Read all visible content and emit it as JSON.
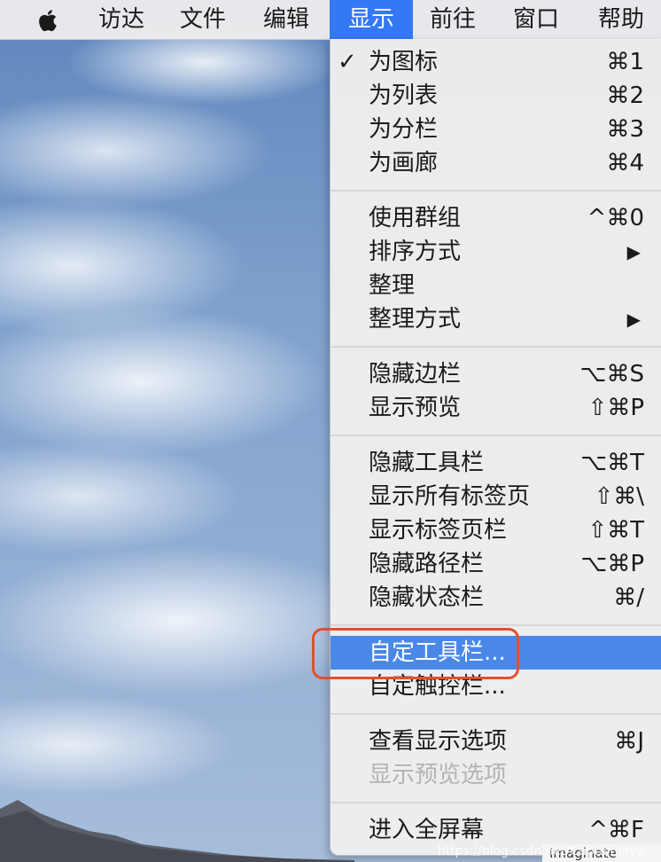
{
  "menubar": {
    "items": [
      {
        "label": "访达"
      },
      {
        "label": "文件"
      },
      {
        "label": "编辑"
      },
      {
        "label": "显示"
      },
      {
        "label": "前往"
      },
      {
        "label": "窗口"
      },
      {
        "label": "帮助"
      }
    ],
    "active_index": 3,
    "apple_icon": "apple-logo-icon"
  },
  "view_menu": {
    "groups": [
      [
        {
          "label": "为图标",
          "shortcut": "⌘1",
          "checked": true
        },
        {
          "label": "为列表",
          "shortcut": "⌘2"
        },
        {
          "label": "为分栏",
          "shortcut": "⌘3"
        },
        {
          "label": "为画廊",
          "shortcut": "⌘4"
        }
      ],
      [
        {
          "label": "使用群组",
          "shortcut": "^⌘0"
        },
        {
          "label": "排序方式",
          "submenu": true
        },
        {
          "label": "整理"
        },
        {
          "label": "整理方式",
          "submenu": true
        }
      ],
      [
        {
          "label": "隐藏边栏",
          "shortcut": "⌥⌘S"
        },
        {
          "label": "显示预览",
          "shortcut": "⇧⌘P"
        }
      ],
      [
        {
          "label": "隐藏工具栏",
          "shortcut": "⌥⌘T"
        },
        {
          "label": "显示所有标签页",
          "shortcut": "⇧⌘\\"
        },
        {
          "label": "显示标签页栏",
          "shortcut": "⇧⌘T"
        },
        {
          "label": "隐藏路径栏",
          "shortcut": "⌥⌘P"
        },
        {
          "label": "隐藏状态栏",
          "shortcut": "⌘/"
        }
      ],
      [
        {
          "label": "自定工具栏...",
          "highlighted": true
        },
        {
          "label": "自定触控栏..."
        }
      ],
      [
        {
          "label": "查看显示选项",
          "shortcut": "⌘J"
        },
        {
          "label": "显示预览选项",
          "disabled": true
        }
      ],
      [
        {
          "label": "进入全屏幕",
          "shortcut": "^⌘F"
        }
      ]
    ],
    "check_mark": "✓",
    "submenu_arrow": "▶"
  },
  "highlight_color": "#4a88e8",
  "menubar_active_color": "#3478f6",
  "callout_color": "#e64e2b",
  "watermark": "https://blog.csdn.net/CaptainJava_",
  "background_window_peek": "Imaginate"
}
